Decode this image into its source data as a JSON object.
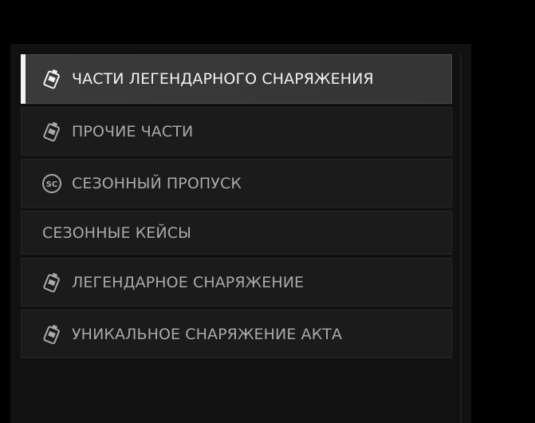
{
  "menu": {
    "items": [
      {
        "label": "ЧАСТИ ЛЕГЕНДАРНОГО СНАРЯЖЕНИЯ",
        "icon": "gear-tag-icon",
        "active": true
      },
      {
        "label": "ПРОЧИЕ ЧАСТИ",
        "icon": "gear-tag-icon",
        "active": false
      },
      {
        "label": "СЕЗОННЫЙ ПРОПУСК",
        "icon": "season-coin-icon",
        "icon_text": "SC",
        "active": false
      },
      {
        "label": "СЕЗОННЫЕ КЕЙСЫ",
        "icon": "",
        "active": false
      },
      {
        "label": "ЛЕГЕНДАРНОЕ СНАРЯЖЕНИЕ",
        "icon": "gear-tag-icon",
        "active": false
      },
      {
        "label": "УНИКАЛЬНОЕ СНАРЯЖЕНИЕ АКТА",
        "icon": "gear-tag-icon",
        "active": false
      }
    ]
  },
  "colors": {
    "background": "#000000",
    "panel": "#111111",
    "item": "#1b1b1b",
    "item_active": "#3a3a3a",
    "accent": "#f4f4f4",
    "text": "#a9a9a9",
    "text_active": "#f2f2f2"
  }
}
